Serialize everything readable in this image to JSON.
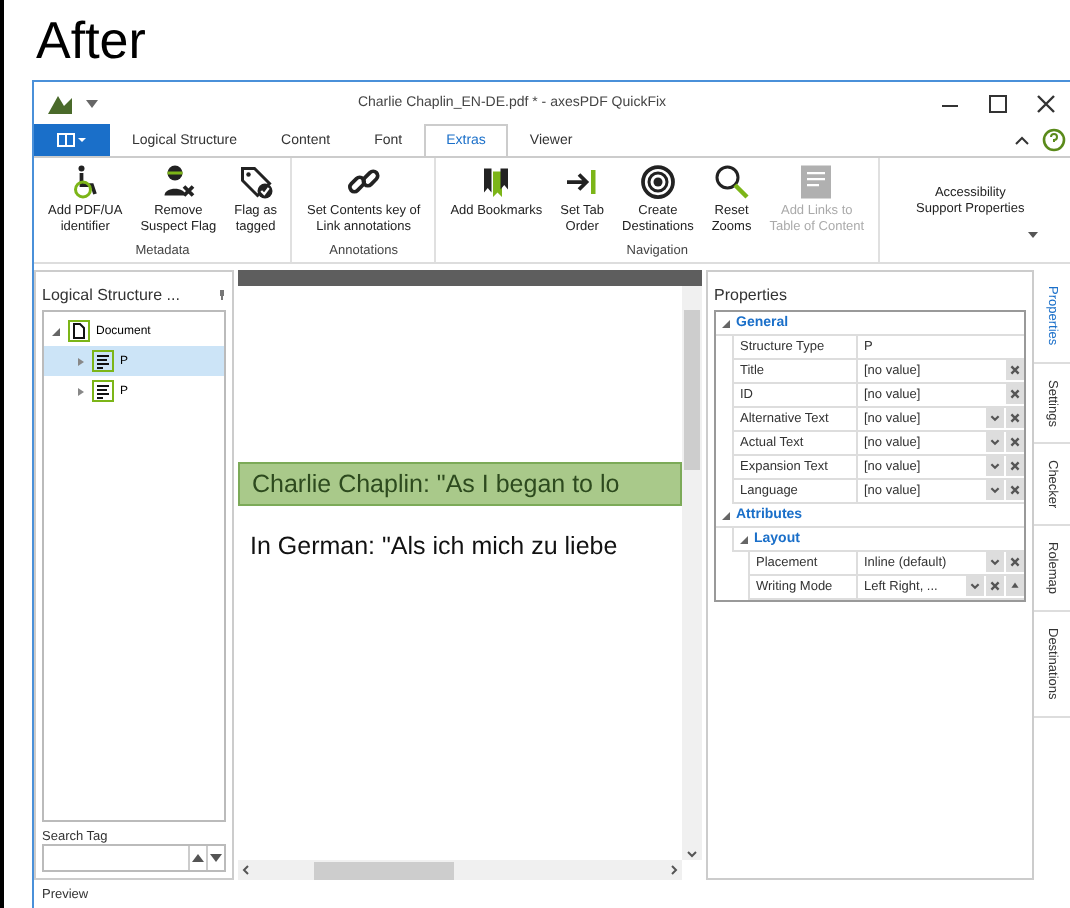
{
  "heading": "After",
  "window": {
    "title": "Charlie Chaplin_EN-DE.pdf * - axesPDF QuickFix"
  },
  "tabs": [
    {
      "label": "Logical Structure",
      "selected": false
    },
    {
      "label": "Content",
      "selected": false
    },
    {
      "label": "Font",
      "selected": false
    },
    {
      "label": "Extras",
      "selected": true
    },
    {
      "label": "Viewer",
      "selected": false
    }
  ],
  "ribbon_groups": [
    {
      "label": "Metadata",
      "buttons": [
        {
          "label": "Add PDF/UA\nidentifier",
          "disabled": false
        },
        {
          "label": "Remove\nSuspect Flag",
          "disabled": false
        },
        {
          "label": "Flag as\ntagged",
          "disabled": false
        }
      ]
    },
    {
      "label": "Annotations",
      "buttons": [
        {
          "label": "Set Contents key of\nLink annotations",
          "disabled": false
        }
      ]
    },
    {
      "label": "Navigation",
      "buttons": [
        {
          "label": "Add Bookmarks",
          "disabled": false
        },
        {
          "label": "Set Tab\nOrder",
          "disabled": false
        },
        {
          "label": "Create\nDestinations",
          "disabled": false
        },
        {
          "label": "Reset\nZooms",
          "disabled": false
        },
        {
          "label": "Add Links to\nTable of Content",
          "disabled": true
        }
      ]
    },
    {
      "buttons": [
        {
          "label": "Accessibility\nSupport Properties",
          "disabled": false
        }
      ]
    }
  ],
  "structure_panel": {
    "title": "Logical Structure ...",
    "tree": [
      {
        "label": "Document",
        "expanded": true,
        "selected": false,
        "children": [
          {
            "label": "P",
            "expanded": false,
            "selected": true
          },
          {
            "label": "P",
            "expanded": false,
            "selected": false
          }
        ]
      }
    ],
    "search_label": "Search Tag"
  },
  "document": {
    "paragraphs": [
      {
        "text": "Charlie Chaplin: \"As I began to lo",
        "highlighted": true
      },
      {
        "text": "In German: \"Als ich mich zu liebe",
        "highlighted": false
      }
    ]
  },
  "properties": {
    "title": "Properties",
    "sections": [
      {
        "label": "General",
        "rows": [
          {
            "name": "Structure Type",
            "value": "P",
            "kind": "plain"
          },
          {
            "name": "Title",
            "value": "[no value]",
            "kind": "clear"
          },
          {
            "name": "ID",
            "value": "[no value]",
            "kind": "clear"
          },
          {
            "name": "Alternative Text",
            "value": "[no value]",
            "kind": "dropdown"
          },
          {
            "name": "Actual Text",
            "value": "[no value]",
            "kind": "dropdown"
          },
          {
            "name": "Expansion Text",
            "value": "[no value]",
            "kind": "dropdown"
          },
          {
            "name": "Language",
            "value": "[no value]",
            "kind": "dropdown"
          }
        ]
      },
      {
        "label": "Attributes",
        "subsections": [
          {
            "label": "Layout",
            "rows": [
              {
                "name": "Placement",
                "value": "Inline (default)",
                "kind": "dropdown"
              },
              {
                "name": "Writing Mode",
                "value": "Left Right, ...",
                "kind": "dropdown_scroll"
              }
            ]
          }
        ]
      }
    ]
  },
  "side_tabs": [
    {
      "label": "Properties",
      "selected": true
    },
    {
      "label": "Settings",
      "selected": false
    },
    {
      "label": "Checker",
      "selected": false
    },
    {
      "label": "Rolemap",
      "selected": false
    },
    {
      "label": "Destinations",
      "selected": false
    }
  ],
  "status_bar": {
    "label": "Preview"
  }
}
